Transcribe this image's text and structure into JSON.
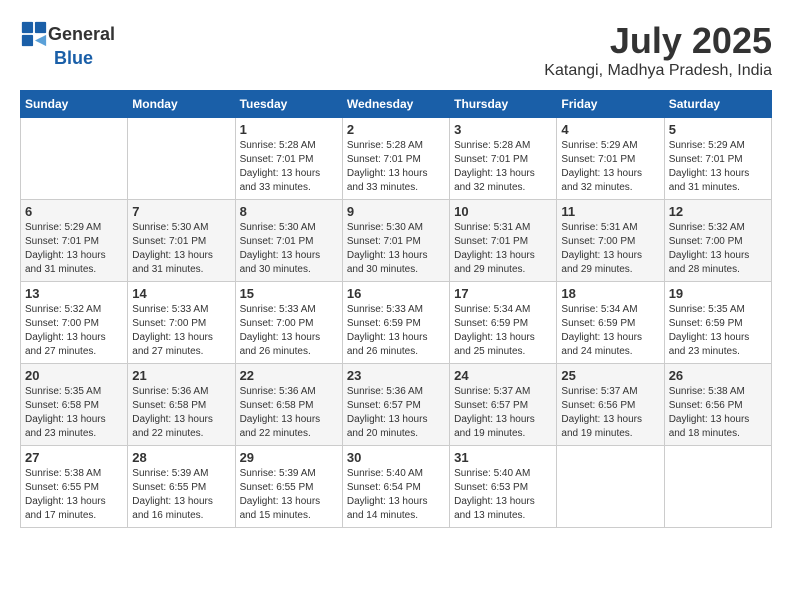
{
  "header": {
    "logo_general": "General",
    "logo_blue": "Blue",
    "month_year": "July 2025",
    "location": "Katangi, Madhya Pradesh, India"
  },
  "weekdays": [
    "Sunday",
    "Monday",
    "Tuesday",
    "Wednesday",
    "Thursday",
    "Friday",
    "Saturday"
  ],
  "weeks": [
    [
      null,
      null,
      {
        "day": "1",
        "sunrise": "Sunrise: 5:28 AM",
        "sunset": "Sunset: 7:01 PM",
        "daylight": "Daylight: 13 hours and 33 minutes."
      },
      {
        "day": "2",
        "sunrise": "Sunrise: 5:28 AM",
        "sunset": "Sunset: 7:01 PM",
        "daylight": "Daylight: 13 hours and 33 minutes."
      },
      {
        "day": "3",
        "sunrise": "Sunrise: 5:28 AM",
        "sunset": "Sunset: 7:01 PM",
        "daylight": "Daylight: 13 hours and 32 minutes."
      },
      {
        "day": "4",
        "sunrise": "Sunrise: 5:29 AM",
        "sunset": "Sunset: 7:01 PM",
        "daylight": "Daylight: 13 hours and 32 minutes."
      },
      {
        "day": "5",
        "sunrise": "Sunrise: 5:29 AM",
        "sunset": "Sunset: 7:01 PM",
        "daylight": "Daylight: 13 hours and 31 minutes."
      }
    ],
    [
      {
        "day": "6",
        "sunrise": "Sunrise: 5:29 AM",
        "sunset": "Sunset: 7:01 PM",
        "daylight": "Daylight: 13 hours and 31 minutes."
      },
      {
        "day": "7",
        "sunrise": "Sunrise: 5:30 AM",
        "sunset": "Sunset: 7:01 PM",
        "daylight": "Daylight: 13 hours and 31 minutes."
      },
      {
        "day": "8",
        "sunrise": "Sunrise: 5:30 AM",
        "sunset": "Sunset: 7:01 PM",
        "daylight": "Daylight: 13 hours and 30 minutes."
      },
      {
        "day": "9",
        "sunrise": "Sunrise: 5:30 AM",
        "sunset": "Sunset: 7:01 PM",
        "daylight": "Daylight: 13 hours and 30 minutes."
      },
      {
        "day": "10",
        "sunrise": "Sunrise: 5:31 AM",
        "sunset": "Sunset: 7:01 PM",
        "daylight": "Daylight: 13 hours and 29 minutes."
      },
      {
        "day": "11",
        "sunrise": "Sunrise: 5:31 AM",
        "sunset": "Sunset: 7:00 PM",
        "daylight": "Daylight: 13 hours and 29 minutes."
      },
      {
        "day": "12",
        "sunrise": "Sunrise: 5:32 AM",
        "sunset": "Sunset: 7:00 PM",
        "daylight": "Daylight: 13 hours and 28 minutes."
      }
    ],
    [
      {
        "day": "13",
        "sunrise": "Sunrise: 5:32 AM",
        "sunset": "Sunset: 7:00 PM",
        "daylight": "Daylight: 13 hours and 27 minutes."
      },
      {
        "day": "14",
        "sunrise": "Sunrise: 5:33 AM",
        "sunset": "Sunset: 7:00 PM",
        "daylight": "Daylight: 13 hours and 27 minutes."
      },
      {
        "day": "15",
        "sunrise": "Sunrise: 5:33 AM",
        "sunset": "Sunset: 7:00 PM",
        "daylight": "Daylight: 13 hours and 26 minutes."
      },
      {
        "day": "16",
        "sunrise": "Sunrise: 5:33 AM",
        "sunset": "Sunset: 6:59 PM",
        "daylight": "Daylight: 13 hours and 26 minutes."
      },
      {
        "day": "17",
        "sunrise": "Sunrise: 5:34 AM",
        "sunset": "Sunset: 6:59 PM",
        "daylight": "Daylight: 13 hours and 25 minutes."
      },
      {
        "day": "18",
        "sunrise": "Sunrise: 5:34 AM",
        "sunset": "Sunset: 6:59 PM",
        "daylight": "Daylight: 13 hours and 24 minutes."
      },
      {
        "day": "19",
        "sunrise": "Sunrise: 5:35 AM",
        "sunset": "Sunset: 6:59 PM",
        "daylight": "Daylight: 13 hours and 23 minutes."
      }
    ],
    [
      {
        "day": "20",
        "sunrise": "Sunrise: 5:35 AM",
        "sunset": "Sunset: 6:58 PM",
        "daylight": "Daylight: 13 hours and 23 minutes."
      },
      {
        "day": "21",
        "sunrise": "Sunrise: 5:36 AM",
        "sunset": "Sunset: 6:58 PM",
        "daylight": "Daylight: 13 hours and 22 minutes."
      },
      {
        "day": "22",
        "sunrise": "Sunrise: 5:36 AM",
        "sunset": "Sunset: 6:58 PM",
        "daylight": "Daylight: 13 hours and 22 minutes."
      },
      {
        "day": "23",
        "sunrise": "Sunrise: 5:36 AM",
        "sunset": "Sunset: 6:57 PM",
        "daylight": "Daylight: 13 hours and 20 minutes."
      },
      {
        "day": "24",
        "sunrise": "Sunrise: 5:37 AM",
        "sunset": "Sunset: 6:57 PM",
        "daylight": "Daylight: 13 hours and 19 minutes."
      },
      {
        "day": "25",
        "sunrise": "Sunrise: 5:37 AM",
        "sunset": "Sunset: 6:56 PM",
        "daylight": "Daylight: 13 hours and 19 minutes."
      },
      {
        "day": "26",
        "sunrise": "Sunrise: 5:38 AM",
        "sunset": "Sunset: 6:56 PM",
        "daylight": "Daylight: 13 hours and 18 minutes."
      }
    ],
    [
      {
        "day": "27",
        "sunrise": "Sunrise: 5:38 AM",
        "sunset": "Sunset: 6:55 PM",
        "daylight": "Daylight: 13 hours and 17 minutes."
      },
      {
        "day": "28",
        "sunrise": "Sunrise: 5:39 AM",
        "sunset": "Sunset: 6:55 PM",
        "daylight": "Daylight: 13 hours and 16 minutes."
      },
      {
        "day": "29",
        "sunrise": "Sunrise: 5:39 AM",
        "sunset": "Sunset: 6:55 PM",
        "daylight": "Daylight: 13 hours and 15 minutes."
      },
      {
        "day": "30",
        "sunrise": "Sunrise: 5:40 AM",
        "sunset": "Sunset: 6:54 PM",
        "daylight": "Daylight: 13 hours and 14 minutes."
      },
      {
        "day": "31",
        "sunrise": "Sunrise: 5:40 AM",
        "sunset": "Sunset: 6:53 PM",
        "daylight": "Daylight: 13 hours and 13 minutes."
      },
      null,
      null
    ]
  ]
}
